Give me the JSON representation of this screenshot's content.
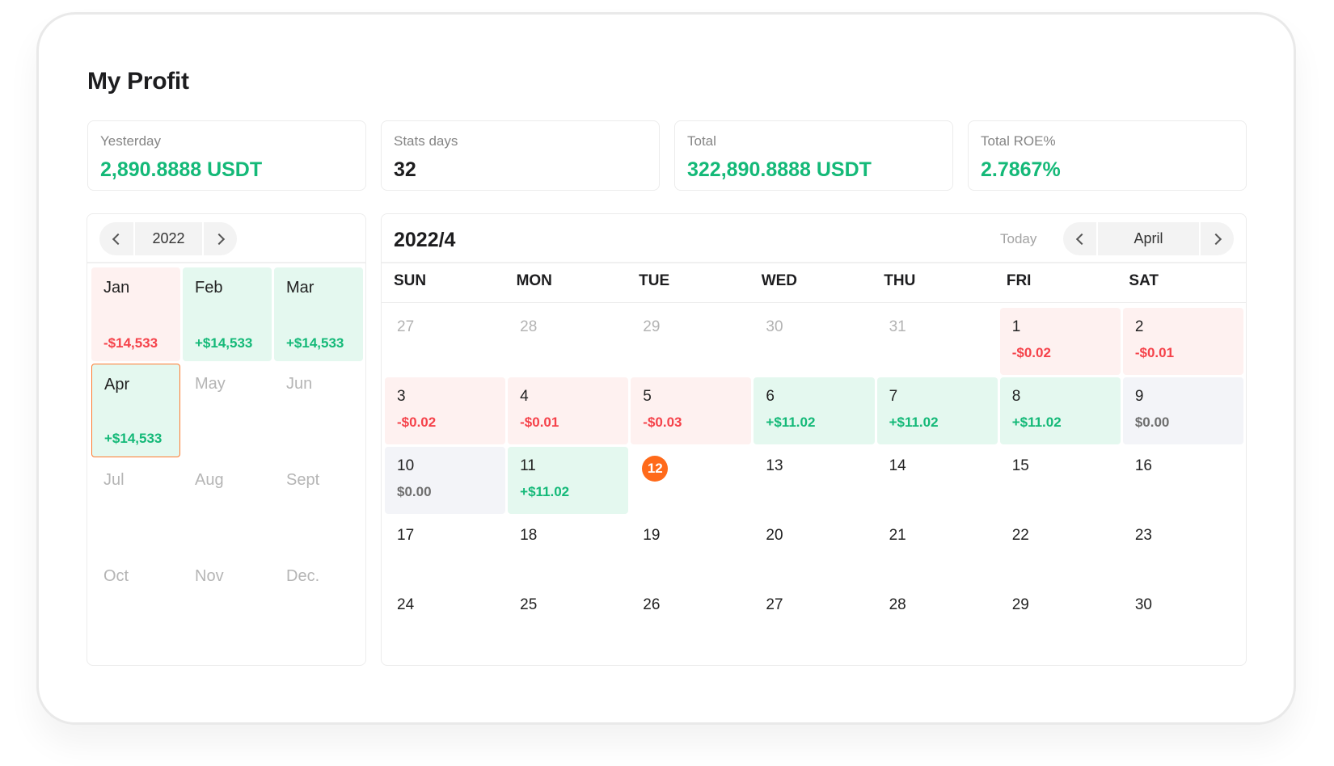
{
  "page": {
    "title": "My Profit"
  },
  "stats": [
    {
      "label": "Yesterday",
      "value": "2,890.8888 USDT",
      "tone": "green"
    },
    {
      "label": "Stats days",
      "value": "32",
      "tone": "dark"
    },
    {
      "label": "Total",
      "value": "322,890.8888 USDT",
      "tone": "green"
    },
    {
      "label": "Total ROE%",
      "value": "2.7867%",
      "tone": "green"
    }
  ],
  "year_panel": {
    "year": "2022",
    "months": [
      {
        "name": "Jan",
        "value": "-$14,533",
        "status": "loss"
      },
      {
        "name": "Feb",
        "value": "+$14,533",
        "status": "profit"
      },
      {
        "name": "Mar",
        "value": "+$14,533",
        "status": "profit"
      },
      {
        "name": "Apr",
        "value": "+$14,533",
        "status": "profit",
        "selected": true
      },
      {
        "name": "May",
        "value": "",
        "status": "future"
      },
      {
        "name": "Jun",
        "value": "",
        "status": "future"
      },
      {
        "name": "Jul",
        "value": "",
        "status": "future"
      },
      {
        "name": "Aug",
        "value": "",
        "status": "future"
      },
      {
        "name": "Sept",
        "value": "",
        "status": "future"
      },
      {
        "name": "Oct",
        "value": "",
        "status": "future"
      },
      {
        "name": "Nov",
        "value": "",
        "status": "future"
      },
      {
        "name": "Dec.",
        "value": "",
        "status": "future"
      }
    ]
  },
  "calendar": {
    "title": "2022/4",
    "today_label": "Today",
    "month_label": "April",
    "weekdays": [
      "SUN",
      "MON",
      "TUE",
      "WED",
      "THU",
      "FRI",
      "SAT"
    ],
    "today": "12",
    "days": [
      {
        "day": "27",
        "value": "",
        "status": "other"
      },
      {
        "day": "28",
        "value": "",
        "status": "other"
      },
      {
        "day": "29",
        "value": "",
        "status": "other"
      },
      {
        "day": "30",
        "value": "",
        "status": "other"
      },
      {
        "day": "31",
        "value": "",
        "status": "other"
      },
      {
        "day": "1",
        "value": "-$0.02",
        "status": "loss"
      },
      {
        "day": "2",
        "value": "-$0.01",
        "status": "loss"
      },
      {
        "day": "3",
        "value": "-$0.02",
        "status": "loss"
      },
      {
        "day": "4",
        "value": "-$0.01",
        "status": "loss"
      },
      {
        "day": "5",
        "value": "-$0.03",
        "status": "loss"
      },
      {
        "day": "6",
        "value": "+$11.02",
        "status": "profit"
      },
      {
        "day": "7",
        "value": "+$11.02",
        "status": "profit"
      },
      {
        "day": "8",
        "value": "+$11.02",
        "status": "profit"
      },
      {
        "day": "9",
        "value": "$0.00",
        "status": "zero"
      },
      {
        "day": "10",
        "value": "$0.00",
        "status": "zero"
      },
      {
        "day": "11",
        "value": "+$11.02",
        "status": "profit"
      },
      {
        "day": "12",
        "value": "",
        "status": "today"
      },
      {
        "day": "13",
        "value": "",
        "status": "none"
      },
      {
        "day": "14",
        "value": "",
        "status": "none"
      },
      {
        "day": "15",
        "value": "",
        "status": "none"
      },
      {
        "day": "16",
        "value": "",
        "status": "none"
      },
      {
        "day": "17",
        "value": "",
        "status": "none"
      },
      {
        "day": "18",
        "value": "",
        "status": "none"
      },
      {
        "day": "19",
        "value": "",
        "status": "none"
      },
      {
        "day": "20",
        "value": "",
        "status": "none"
      },
      {
        "day": "21",
        "value": "",
        "status": "none"
      },
      {
        "day": "22",
        "value": "",
        "status": "none"
      },
      {
        "day": "23",
        "value": "",
        "status": "none"
      },
      {
        "day": "24",
        "value": "",
        "status": "none"
      },
      {
        "day": "25",
        "value": "",
        "status": "none"
      },
      {
        "day": "26",
        "value": "",
        "status": "none"
      },
      {
        "day": "27",
        "value": "",
        "status": "none"
      },
      {
        "day": "28",
        "value": "",
        "status": "none"
      },
      {
        "day": "29",
        "value": "",
        "status": "none"
      },
      {
        "day": "30",
        "value": "",
        "status": "none"
      }
    ]
  },
  "colors": {
    "profit_text": "#14b978",
    "profit_bg": "#e4f8ef",
    "loss_text": "#f5424a",
    "loss_bg": "#fef1f0",
    "zero_text": "#6e6e6e",
    "zero_bg": "#f3f4f8",
    "accent": "#ff6a1a"
  }
}
